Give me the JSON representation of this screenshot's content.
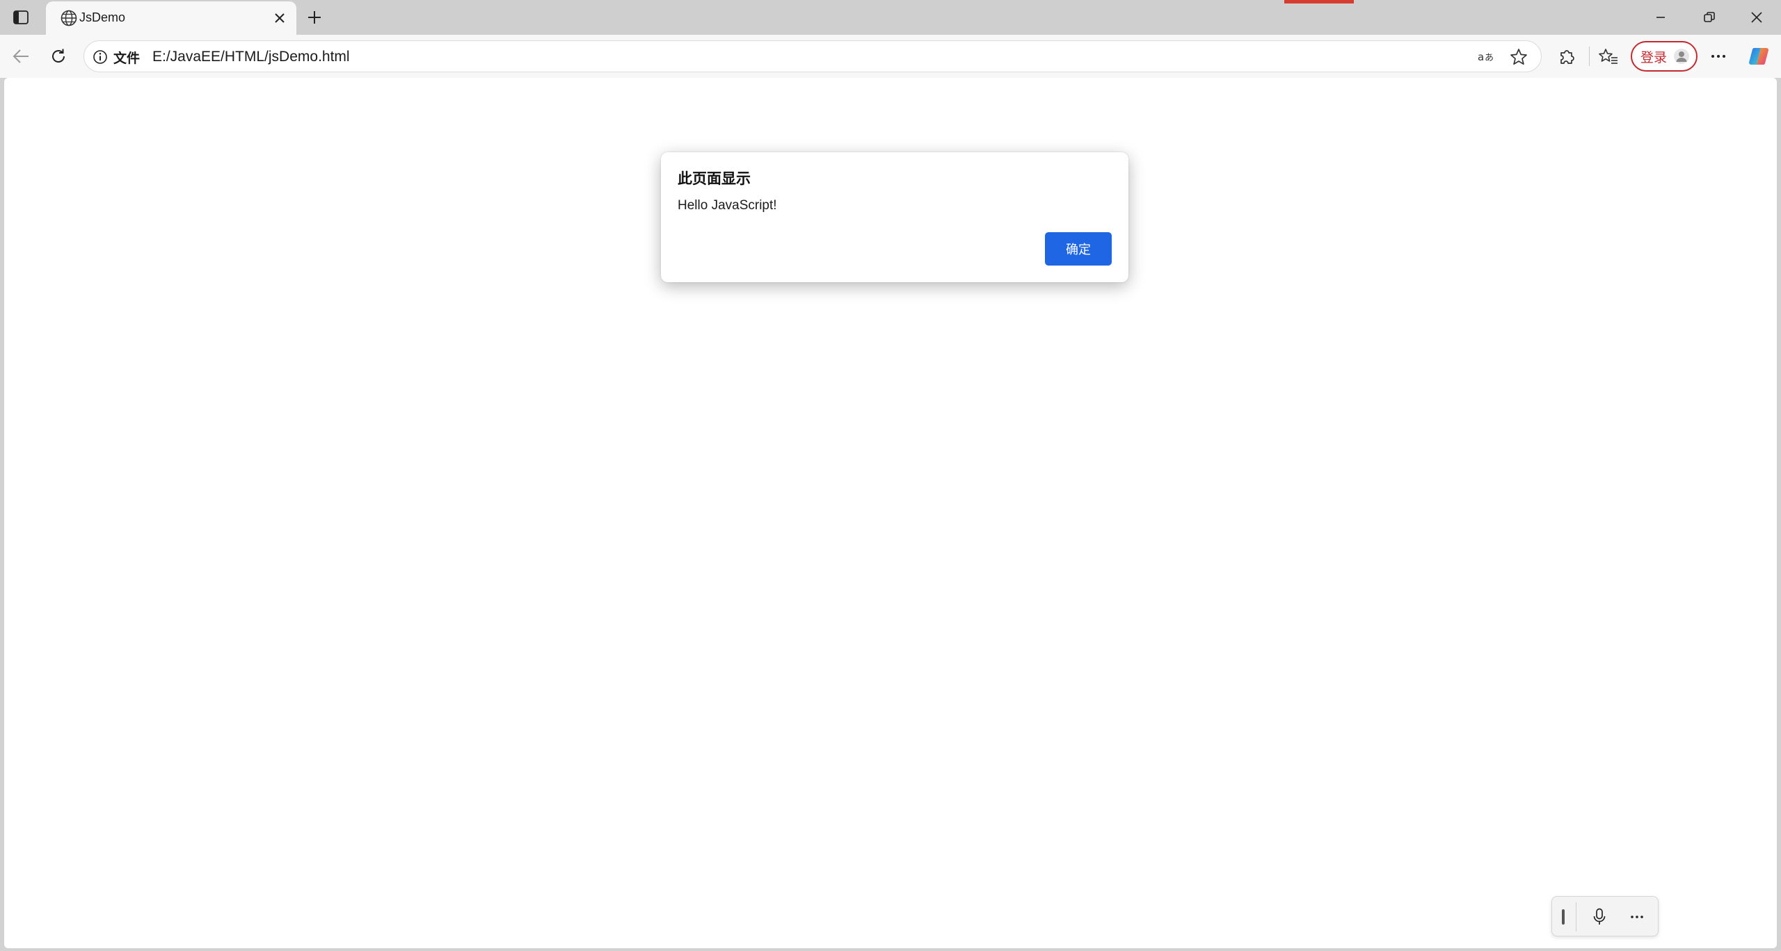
{
  "tab": {
    "title": "JsDemo",
    "favicon": "globe-icon"
  },
  "toolbar": {
    "site_info_label": "文件",
    "url": "E:/JavaEE/HTML/jsDemo.html",
    "signin_label": "登录",
    "signin_color": "#c4292f"
  },
  "alert": {
    "title": "此页面显示",
    "message": "Hello JavaScript!",
    "ok_label": "确定",
    "button_color": "#1f66e5"
  },
  "icons": {
    "sidebar": "sidebar-toggle-icon",
    "close_tab": "close-icon",
    "new_tab": "plus-icon",
    "back": "arrow-left-icon",
    "reload": "reload-icon",
    "site_info": "info-icon",
    "read_aloud": "read-aloud-icon",
    "favorite": "star-icon",
    "extensions": "puzzle-icon",
    "favorites": "favorites-icon",
    "more": "more-icon",
    "copilot": "copilot-icon",
    "mic": "microphone-icon"
  }
}
